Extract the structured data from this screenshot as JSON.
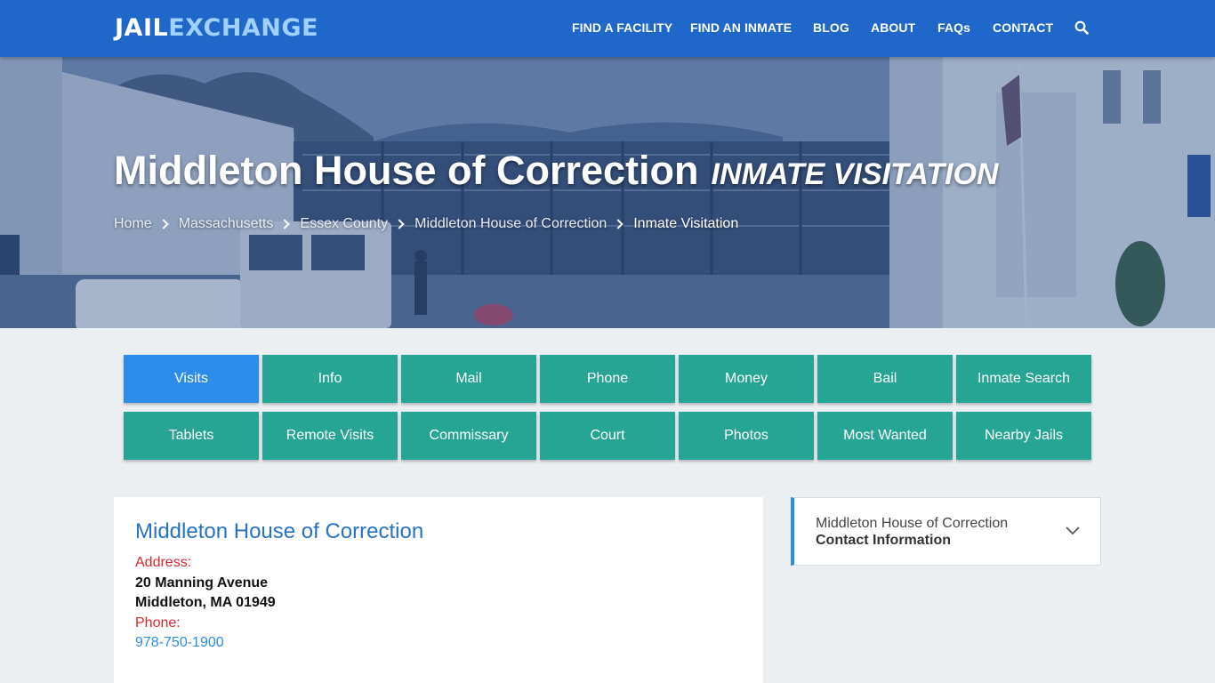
{
  "header": {
    "logo_part1": "JAIL",
    "logo_part2": "EXCHANGE",
    "nav": [
      {
        "label": "FIND A FACILITY"
      },
      {
        "label": "FIND AN INMATE"
      },
      {
        "label": "BLOG"
      },
      {
        "label": "ABOUT"
      },
      {
        "label": "FAQs"
      },
      {
        "label": "CONTACT"
      }
    ],
    "search_icon": "search-icon"
  },
  "hero": {
    "title": "Middleton House of Correction",
    "subtitle": "Inmate Visitation",
    "breadcrumb": [
      "Home",
      "Massachusetts",
      "Essex County",
      "Middleton House of Correction",
      "Inmate Visitation"
    ]
  },
  "tabs": {
    "row1": [
      "Visits",
      "Info",
      "Mail",
      "Phone",
      "Money",
      "Bail",
      "Inmate Search"
    ],
    "row2": [
      "Tablets",
      "Remote Visits",
      "Commissary",
      "Court",
      "Photos",
      "Most Wanted",
      "Nearby Jails"
    ],
    "active": "Visits"
  },
  "facility": {
    "name": "Middleton House of Correction",
    "address_label": "Address:",
    "address_line1": "20 Manning Avenue",
    "address_line2": "Middleton, MA 01949",
    "phone_label": "Phone:",
    "phone": "978-750-1900"
  },
  "sidebar": {
    "line1": "Middleton House of Correction",
    "line2": "Contact Information",
    "toggle_icon": "chevron-down-icon"
  },
  "colors": {
    "header_blue": "#1f68c9",
    "tab_teal": "#27a594",
    "tab_active_blue": "#2b8cea",
    "label_red": "#d6282e",
    "link_blue": "#2672c4"
  }
}
